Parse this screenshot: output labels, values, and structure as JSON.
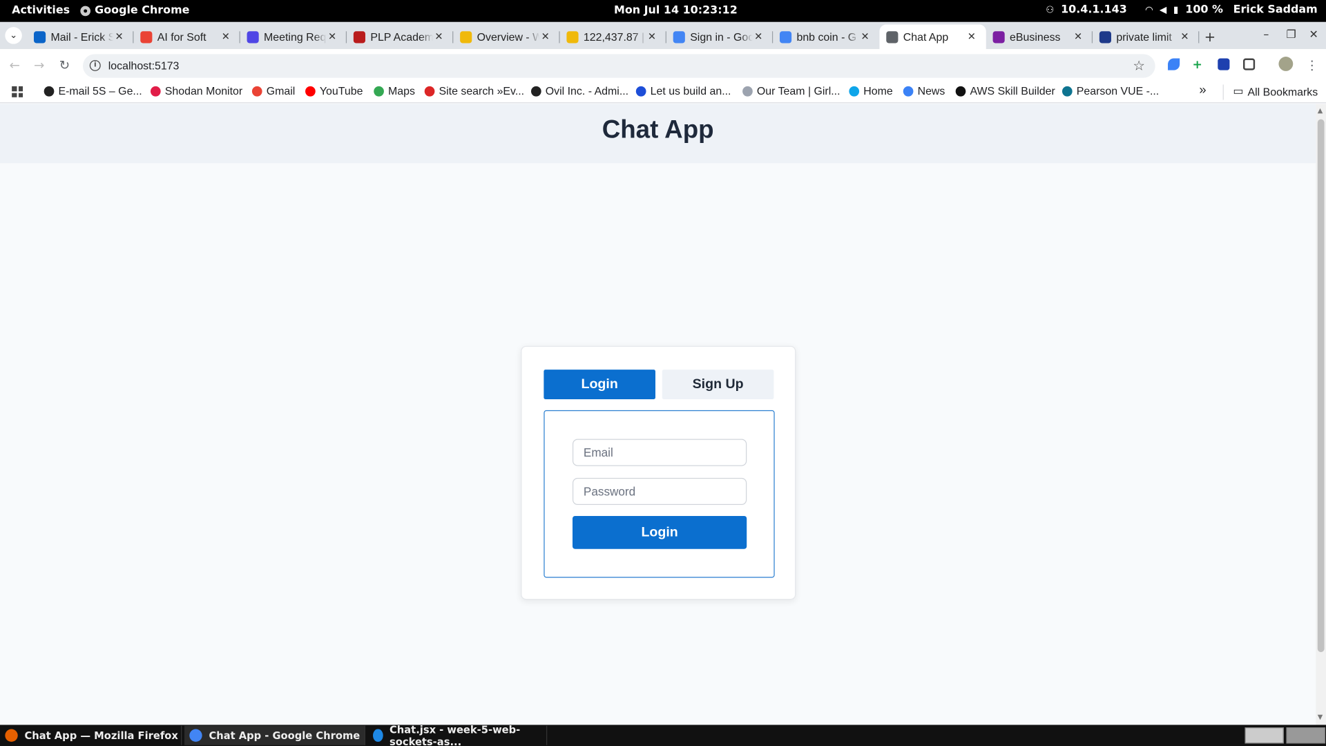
{
  "system_bar": {
    "activities": "Activities",
    "app_name": "Google Chrome",
    "clock": "Mon Jul 14  10:23:12",
    "ip": "10.4.1.143",
    "battery": "100 %",
    "user": "Erick Saddam"
  },
  "browser": {
    "tabs": [
      {
        "title": "Mail - Erick S",
        "color": "#0a64c8",
        "active": false
      },
      {
        "title": "AI for Soft",
        "color": "#ea4335",
        "active": false
      },
      {
        "title": "Meeting Req",
        "color": "#4f46e5",
        "active": false
      },
      {
        "title": "PLP Academ",
        "color": "#b91c1c",
        "active": false
      },
      {
        "title": "Overview - W",
        "color": "#f0b90b",
        "active": false
      },
      {
        "title": "122,437.87 |",
        "color": "#f0b90b",
        "active": false
      },
      {
        "title": "Sign in - Goo",
        "color": "#4285f4",
        "active": false
      },
      {
        "title": "bnb coin - G",
        "color": "#4285f4",
        "active": false
      },
      {
        "title": "Chat App",
        "color": "#5f6368",
        "active": true
      },
      {
        "title": "eBusiness",
        "color": "#7c1fa2",
        "active": false
      },
      {
        "title": "private limit",
        "color": "#1e3a8a",
        "active": false
      }
    ],
    "url": "localhost:5173",
    "bookmarks": [
      {
        "label": "E-mail 5S – Ge...",
        "color": "#222"
      },
      {
        "label": "Shodan Monitor",
        "color": "#e11d48"
      },
      {
        "label": "Gmail",
        "color": "#ea4335"
      },
      {
        "label": "YouTube",
        "color": "#ff0000"
      },
      {
        "label": "Maps",
        "color": "#34a853"
      },
      {
        "label": "Site search »Ev...",
        "color": "#dc2626"
      },
      {
        "label": "Ovil Inc. - Admi...",
        "color": "#222"
      },
      {
        "label": "Let us build an...",
        "color": "#1d4ed8"
      },
      {
        "label": "Our Team | Girl...",
        "color": "#9ca3af"
      },
      {
        "label": "Home",
        "color": "#0ea5e9"
      },
      {
        "label": "News",
        "color": "#3b82f6"
      },
      {
        "label": "AWS Skill Builder",
        "color": "#111"
      },
      {
        "label": "Pearson VUE -...",
        "color": "#0e7490"
      }
    ],
    "all_bookmarks": "All Bookmarks",
    "overflow": "»"
  },
  "app": {
    "title": "Chat App",
    "tab_login": "Login",
    "tab_signup": "Sign Up",
    "email_placeholder": "Email",
    "password_placeholder": "Password",
    "submit_label": "Login"
  },
  "taskbar": {
    "items": [
      {
        "label": "Chat App — Mozilla Firefox",
        "active": false
      },
      {
        "label": "Chat App - Google Chrome",
        "active": true
      },
      {
        "label": "Chat.jsx - week-5-web-sockets-as...",
        "active": false
      }
    ]
  },
  "colors": {
    "accent": "#0b6fcf",
    "title": "#1e293b"
  }
}
